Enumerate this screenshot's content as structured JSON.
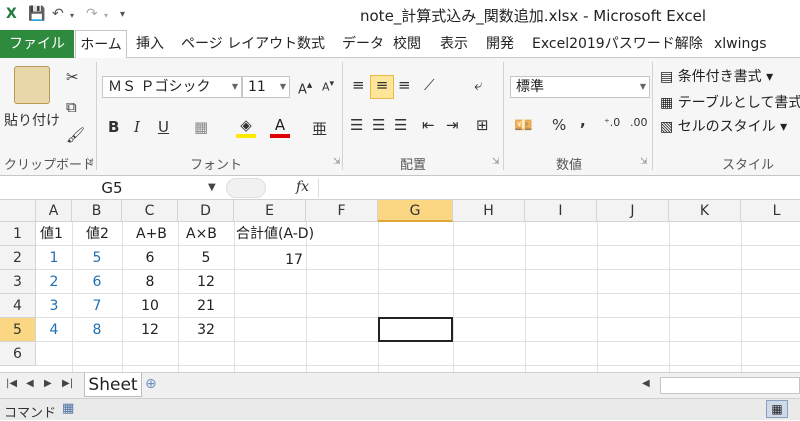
{
  "window": {
    "title": "note_計算式込み_関数追加.xlsx - Microsoft Excel"
  },
  "tabs": [
    "ファイル",
    "ホーム",
    "挿入",
    "ページ レイアウト",
    "数式",
    "データ",
    "校閲",
    "表示",
    "開発",
    "Excel2019パスワード解除",
    "xlwings"
  ],
  "ribbon": {
    "clipboard": {
      "label": "クリップボード",
      "paste": "貼り付け"
    },
    "font": {
      "label": "フォント",
      "name": "ＭＳ Ｐゴシック",
      "size": "11",
      "bold": "B",
      "italic": "I",
      "underline": "U"
    },
    "alignment": {
      "label": "配置"
    },
    "number": {
      "label": "数値",
      "format": "標準",
      "percent": "%",
      "comma": ","
    },
    "styles": {
      "label": "スタイル",
      "conditional": "条件付き書式 ▾",
      "table": "テーブルとして書式設",
      "cell": "セルのスタイル ▾"
    }
  },
  "formula_bar": {
    "name_box": "G5",
    "fx": "fx"
  },
  "columns": [
    "A",
    "B",
    "C",
    "D",
    "E",
    "F",
    "G",
    "H",
    "I",
    "J",
    "K",
    "L"
  ],
  "rows": [
    "1",
    "2",
    "3",
    "4",
    "5",
    "6"
  ],
  "headers": {
    "A": "値1",
    "B": "値2",
    "C": "A+B",
    "D": "A×B",
    "E": "合計値(A-D)"
  },
  "table": [
    {
      "a": "1",
      "b": "5",
      "c": "6",
      "d": "5",
      "e": "17"
    },
    {
      "a": "2",
      "b": "6",
      "c": "8",
      "d": "12",
      "e": ""
    },
    {
      "a": "3",
      "b": "7",
      "c": "10",
      "d": "21",
      "e": ""
    },
    {
      "a": "4",
      "b": "8",
      "c": "12",
      "d": "32",
      "e": ""
    }
  ],
  "sheet": {
    "name": "Sheet"
  },
  "status": {
    "mode": "コマンド"
  }
}
